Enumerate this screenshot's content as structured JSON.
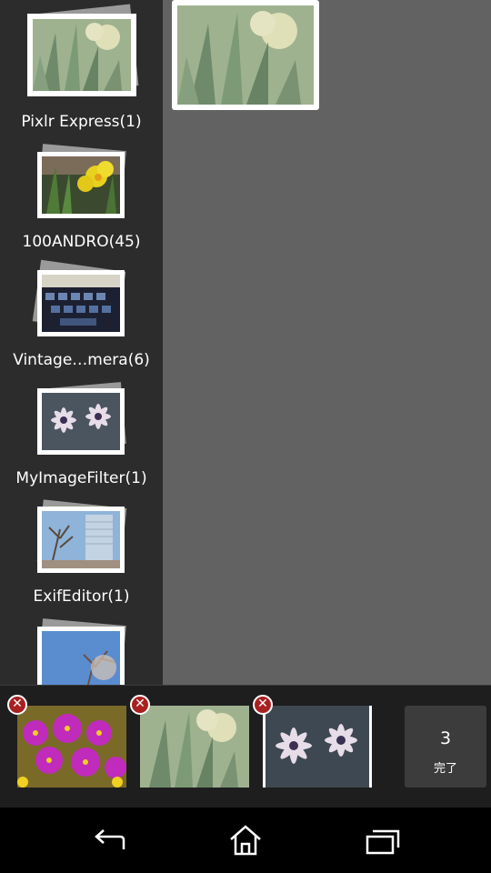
{
  "albums": [
    {
      "label": "Pixlr Express(1)",
      "photo": "daffodil-faded"
    },
    {
      "label": "100ANDRO(45)",
      "photo": "daffodil-yellow"
    },
    {
      "label": "Vintage…mera(6)",
      "photo": "keyboard"
    },
    {
      "label": "MyImageFilter(1)",
      "photo": "daisy"
    },
    {
      "label": "ExifEditor(1)",
      "photo": "building"
    },
    {
      "label": "",
      "photo": "sky-tree"
    }
  ],
  "grid": {
    "selected_photo": "daffodil-faded"
  },
  "tray": {
    "items": [
      {
        "photo": "purple-flowers",
        "remove_icon": "remove-icon"
      },
      {
        "photo": "daffodil-faded",
        "remove_icon": "remove-icon"
      },
      {
        "photo": "daisy",
        "remove_icon": "remove-icon"
      }
    ],
    "done": {
      "count": "3",
      "label": "完了"
    }
  },
  "navbar": {
    "back_icon": "back-icon",
    "home_icon": "home-icon",
    "recents_icon": "recents-icon"
  },
  "colors": {
    "sidebar": "#2c2c2c",
    "main": "#626262",
    "tray": "#1e1e1e",
    "remove": "#a82020",
    "done": "#3c3c3c"
  }
}
